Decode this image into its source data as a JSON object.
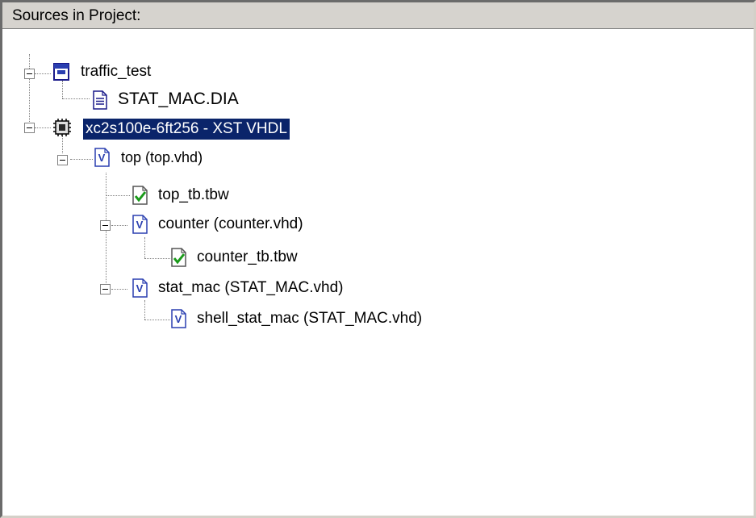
{
  "panel": {
    "title": "Sources in Project:"
  },
  "tree": {
    "items": [
      {
        "label": "traffic_test",
        "icon": "project-icon"
      },
      {
        "label": "STAT_MAC.DIA",
        "icon": "document-icon"
      },
      {
        "label": "xc2s100e-6ft256 - XST VHDL",
        "icon": "chip-icon",
        "selected": true
      },
      {
        "label": "top (top.vhd)",
        "icon": "vhdl-file-icon"
      },
      {
        "label": "top_tb.tbw",
        "icon": "testbench-icon"
      },
      {
        "label": "counter (counter.vhd)",
        "icon": "vhdl-file-icon"
      },
      {
        "label": "counter_tb.tbw",
        "icon": "testbench-icon"
      },
      {
        "label": "stat_mac (STAT_MAC.vhd)",
        "icon": "vhdl-file-icon"
      },
      {
        "label": "shell_stat_mac (STAT_MAC.vhd)",
        "icon": "vhdl-file-icon"
      }
    ]
  },
  "colors": {
    "selection_bg": "#0a246a",
    "selection_fg": "#ffffff",
    "header_bg": "#d6d3ce",
    "check_green": "#1a9a1a",
    "vhdl_blue": "#2a3fb0"
  }
}
